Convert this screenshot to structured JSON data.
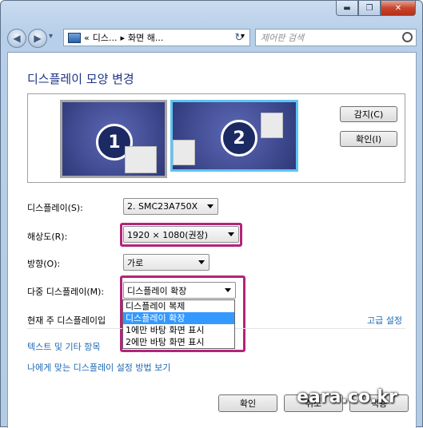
{
  "window": {
    "controls": {
      "minimize": "▬",
      "maximize": "❐",
      "close": "✕"
    }
  },
  "address": {
    "back": "◀",
    "forward": "▶",
    "nav_dropdown": "▾",
    "sep1": "«",
    "crumb1": "디스...",
    "sep2": "▸",
    "crumb2": "화면 해...",
    "dropdown": "▾",
    "refresh": "↻"
  },
  "search": {
    "placeholder": "제어판 검색"
  },
  "page": {
    "title": "디스플레이 모양 변경"
  },
  "monitors": {
    "m1": "1",
    "m2": "2"
  },
  "buttons": {
    "detect": "감지(C)",
    "identify": "확인(I)"
  },
  "settings": {
    "display_label": "디스플레이(S):",
    "display_value": "2. SMC23A750X",
    "resolution_label": "해상도(R):",
    "resolution_value": "1920 × 1080(권장)",
    "orientation_label": "방향(O):",
    "orientation_value": "가로",
    "multi_label": "다중 디스플레이(M):",
    "multi_value": "디스플레이 확장",
    "multi_options": [
      "디스플레이 복제",
      "디스플레이 확장",
      "1에만 바탕 화면 표시",
      "2에만 바탕 화면 표시"
    ]
  },
  "main_display_text": "현재 주 디스플레이입",
  "links": {
    "advanced": "고급 설정",
    "text_size": "텍스트 및 기타 항목",
    "help": "나에게 맞는 디스플레이 설정 방법 보기"
  },
  "footer": {
    "ok": "확인",
    "cancel": "취소",
    "apply": "적용"
  },
  "watermark": "eara.co.kr",
  "colors": {
    "highlight": "#b4237a",
    "link": "#1c6ab5",
    "selection": "#3399ff",
    "title": "#1e3287"
  }
}
